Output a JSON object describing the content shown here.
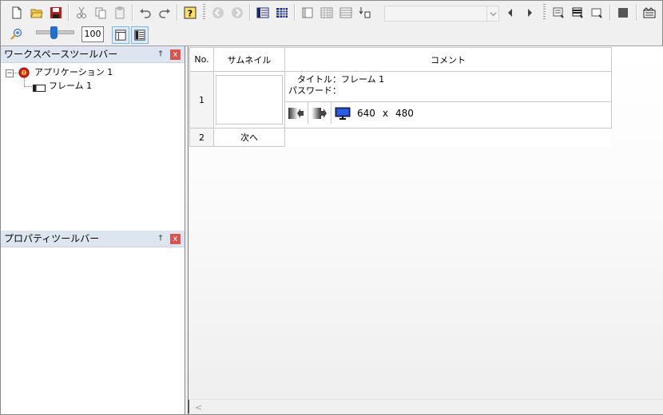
{
  "toolbar": {
    "zoom_value": "100"
  },
  "workspace": {
    "title": "ワークスペースツールバー",
    "pin": "†",
    "close": "x",
    "tree": {
      "root_label": "アプリケーション 1",
      "child_label": "フレーム 1",
      "expander": "−"
    }
  },
  "properties": {
    "title": "プロパティツールバー",
    "pin": "†",
    "close": "x"
  },
  "grid": {
    "headers": {
      "no": "No.",
      "thumbnail": "サムネイル",
      "comment": "コメント"
    },
    "rows": [
      {
        "no": "1",
        "title_line": "　タイトル：フレーム 1",
        "password_line": "パスワード：",
        "size_w": "640",
        "size_x": "x",
        "size_h": "480"
      },
      {
        "no": "2",
        "next_label": "次へ"
      }
    ]
  },
  "scroll": {
    "left_arrow": "<"
  }
}
